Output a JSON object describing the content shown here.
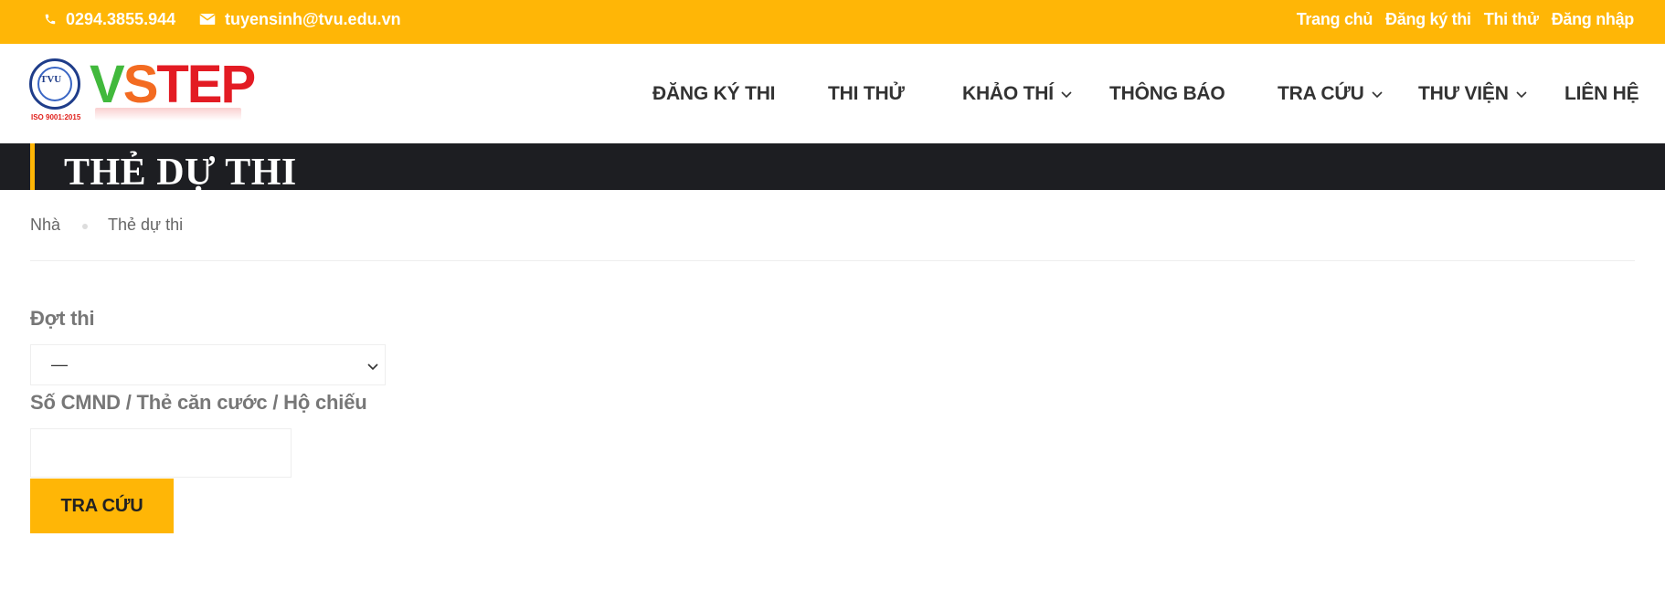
{
  "topbar": {
    "phone": "0294.3855.944",
    "email": "tuyensinh@tvu.edu.vn",
    "links": [
      "Trang chủ",
      "Đăng ký thi",
      "Thi thử",
      "Đăng nhập"
    ],
    "color": "#ffb606"
  },
  "logo": {
    "seal_text": "TVU",
    "iso": "ISO 9001:2015",
    "word_v": "V",
    "word_s": "S",
    "word_tep": "TEP"
  },
  "nav": {
    "items": [
      {
        "label": "ĐĂNG KÝ THI",
        "has_dropdown": false
      },
      {
        "label": "THI THỬ",
        "has_dropdown": false
      },
      {
        "label": "KHẢO THÍ",
        "has_dropdown": true
      },
      {
        "label": "THÔNG BÁO",
        "has_dropdown": false
      },
      {
        "label": "TRA CỨU",
        "has_dropdown": true
      },
      {
        "label": "THƯ VIỆN",
        "has_dropdown": true
      },
      {
        "label": "LIÊN HỆ",
        "has_dropdown": false
      }
    ]
  },
  "page": {
    "title": "THẺ DỰ THI"
  },
  "breadcrumb": {
    "home": "Nhà",
    "current": "Thẻ dự thi"
  },
  "form": {
    "exam_label": "Đợt thi",
    "exam_selected": "—",
    "id_label": "Số CMND / Thẻ căn cước / Hộ chiếu",
    "id_value": "",
    "submit_label": "TRA CỨU"
  }
}
